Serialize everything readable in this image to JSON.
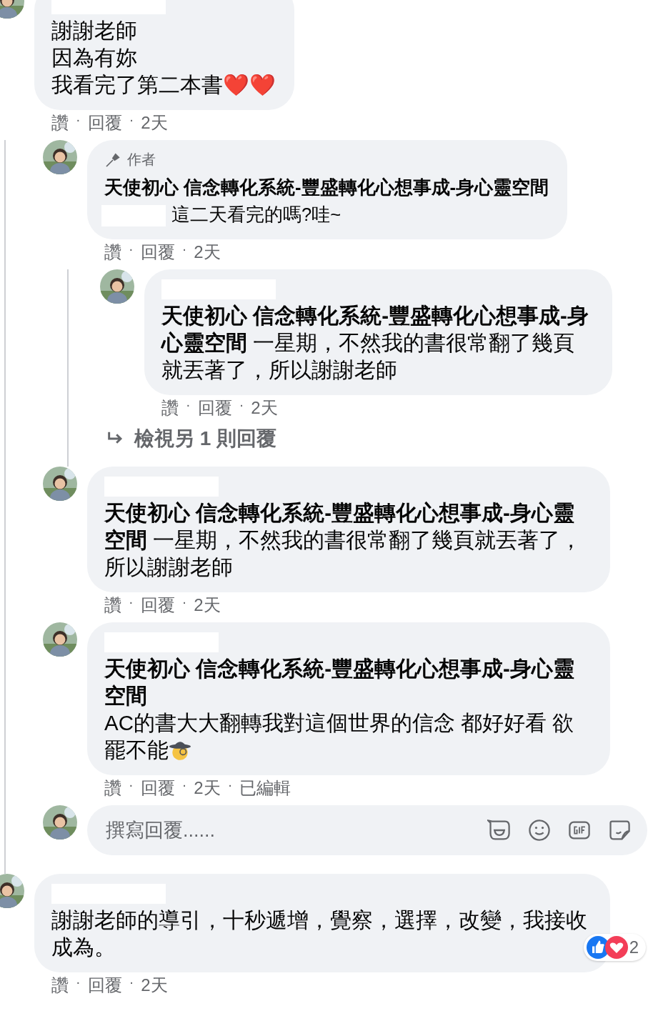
{
  "separator": "·",
  "comments": [
    {
      "name_redacted": true,
      "lines": [
        "謝謝老師",
        "因為有妳",
        "我看完了第二本書❤️❤️"
      ],
      "actions": [
        "讚",
        "回覆",
        "2天"
      ],
      "replies": [
        {
          "author_label": "作者",
          "mention": "天使初心 信念轉化系統-豐盛轉化心想事成-身心靈空間",
          "mention_break": true,
          "reply_to_redacted": true,
          "text": "這二天看完的嗎?哇~",
          "actions": [
            "讚",
            "回覆",
            "2天"
          ],
          "replies": [
            {
              "name_redacted": true,
              "mention": "天使初心 信念轉化系統-豐盛轉化心想事成-身心靈空間",
              "text": " 一星期，不然我的書很常翻了幾頁就丟著了，所以謝謝老師",
              "actions": [
                "讚",
                "回覆",
                "2天"
              ]
            }
          ],
          "more_replies": "檢視另 1 則回覆"
        },
        {
          "name_redacted": true,
          "mention": "天使初心 信念轉化系統-豐盛轉化心想事成-身心靈空間",
          "text": " 一星期，不然我的書很常翻了幾頁就丟著了，所以謝謝老師",
          "actions": [
            "讚",
            "回覆",
            "2天"
          ]
        },
        {
          "name_redacted": true,
          "mention": "天使初心 信念轉化系統-豐盛轉化心想事成-身心靈空間",
          "mention_break": true,
          "text": "AC的書大大翻轉我對這個世界的信念 都好好看 欲罷不能",
          "emoji": {
            "kind": "detective"
          },
          "actions": [
            "讚",
            "回覆",
            "2天",
            "已編輯"
          ]
        }
      ],
      "composer": {
        "placeholder": "撰寫回覆......"
      }
    },
    {
      "name_redacted": true,
      "text": "謝謝老師的導引，十秒遞增，覺察，選擇，改變，我接收成為。",
      "actions": [
        "讚",
        "回覆",
        "2天"
      ],
      "reactions": {
        "count": "2"
      }
    }
  ]
}
